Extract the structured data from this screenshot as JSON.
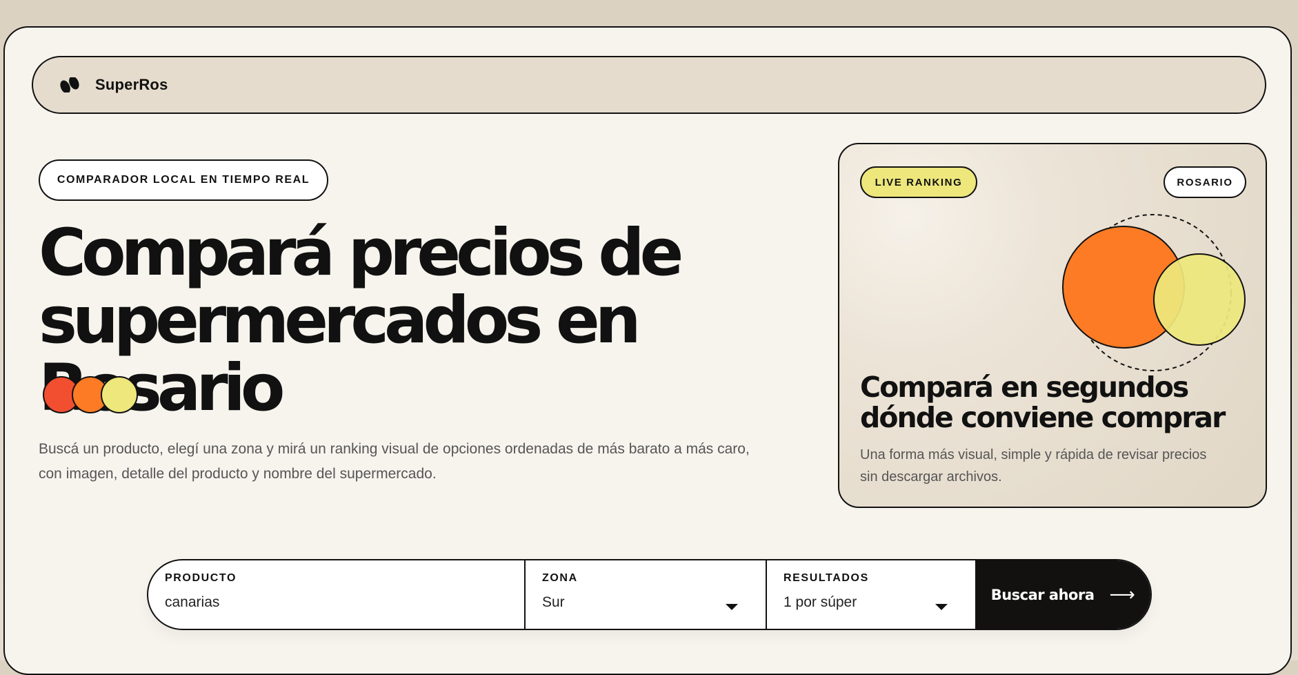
{
  "nav": {
    "brand": "SuperRos",
    "logo_icon": "double-blob-logo-icon"
  },
  "hero": {
    "eyebrow": "COMPARADOR LOCAL EN TIEMPO REAL",
    "title_line1": "Compará precios de",
    "title_line2": "supermercados en Rosario",
    "dot_colors": [
      "#f24f30",
      "#fc7b24",
      "#ede77c"
    ],
    "description": "Buscá un producto, elegí una zona y mirá un ranking visual de opciones ordenadas de más barato a más caro, con imagen, detalle del producto y nombre del supermercado."
  },
  "card": {
    "badge_live": "LIVE RANKING",
    "badge_city": "ROSARIO",
    "title_line1": "Compará en segundos",
    "title_line2": "dónde conviene comprar",
    "text": "Una forma más visual, simple y rápida de revisar precios sin descargar archivos.",
    "colors": {
      "orange": "#fc7b24",
      "yellow": "#ede77c"
    }
  },
  "search": {
    "product_label": "PRODUCTO",
    "product_value": "canarias",
    "zone_label": "ZONA",
    "zone_value": "Sur",
    "results_label": "RESULTADOS",
    "results_value": "1 por súper",
    "button_label": "Buscar ahora",
    "button_icon": "arrow-right-icon"
  }
}
